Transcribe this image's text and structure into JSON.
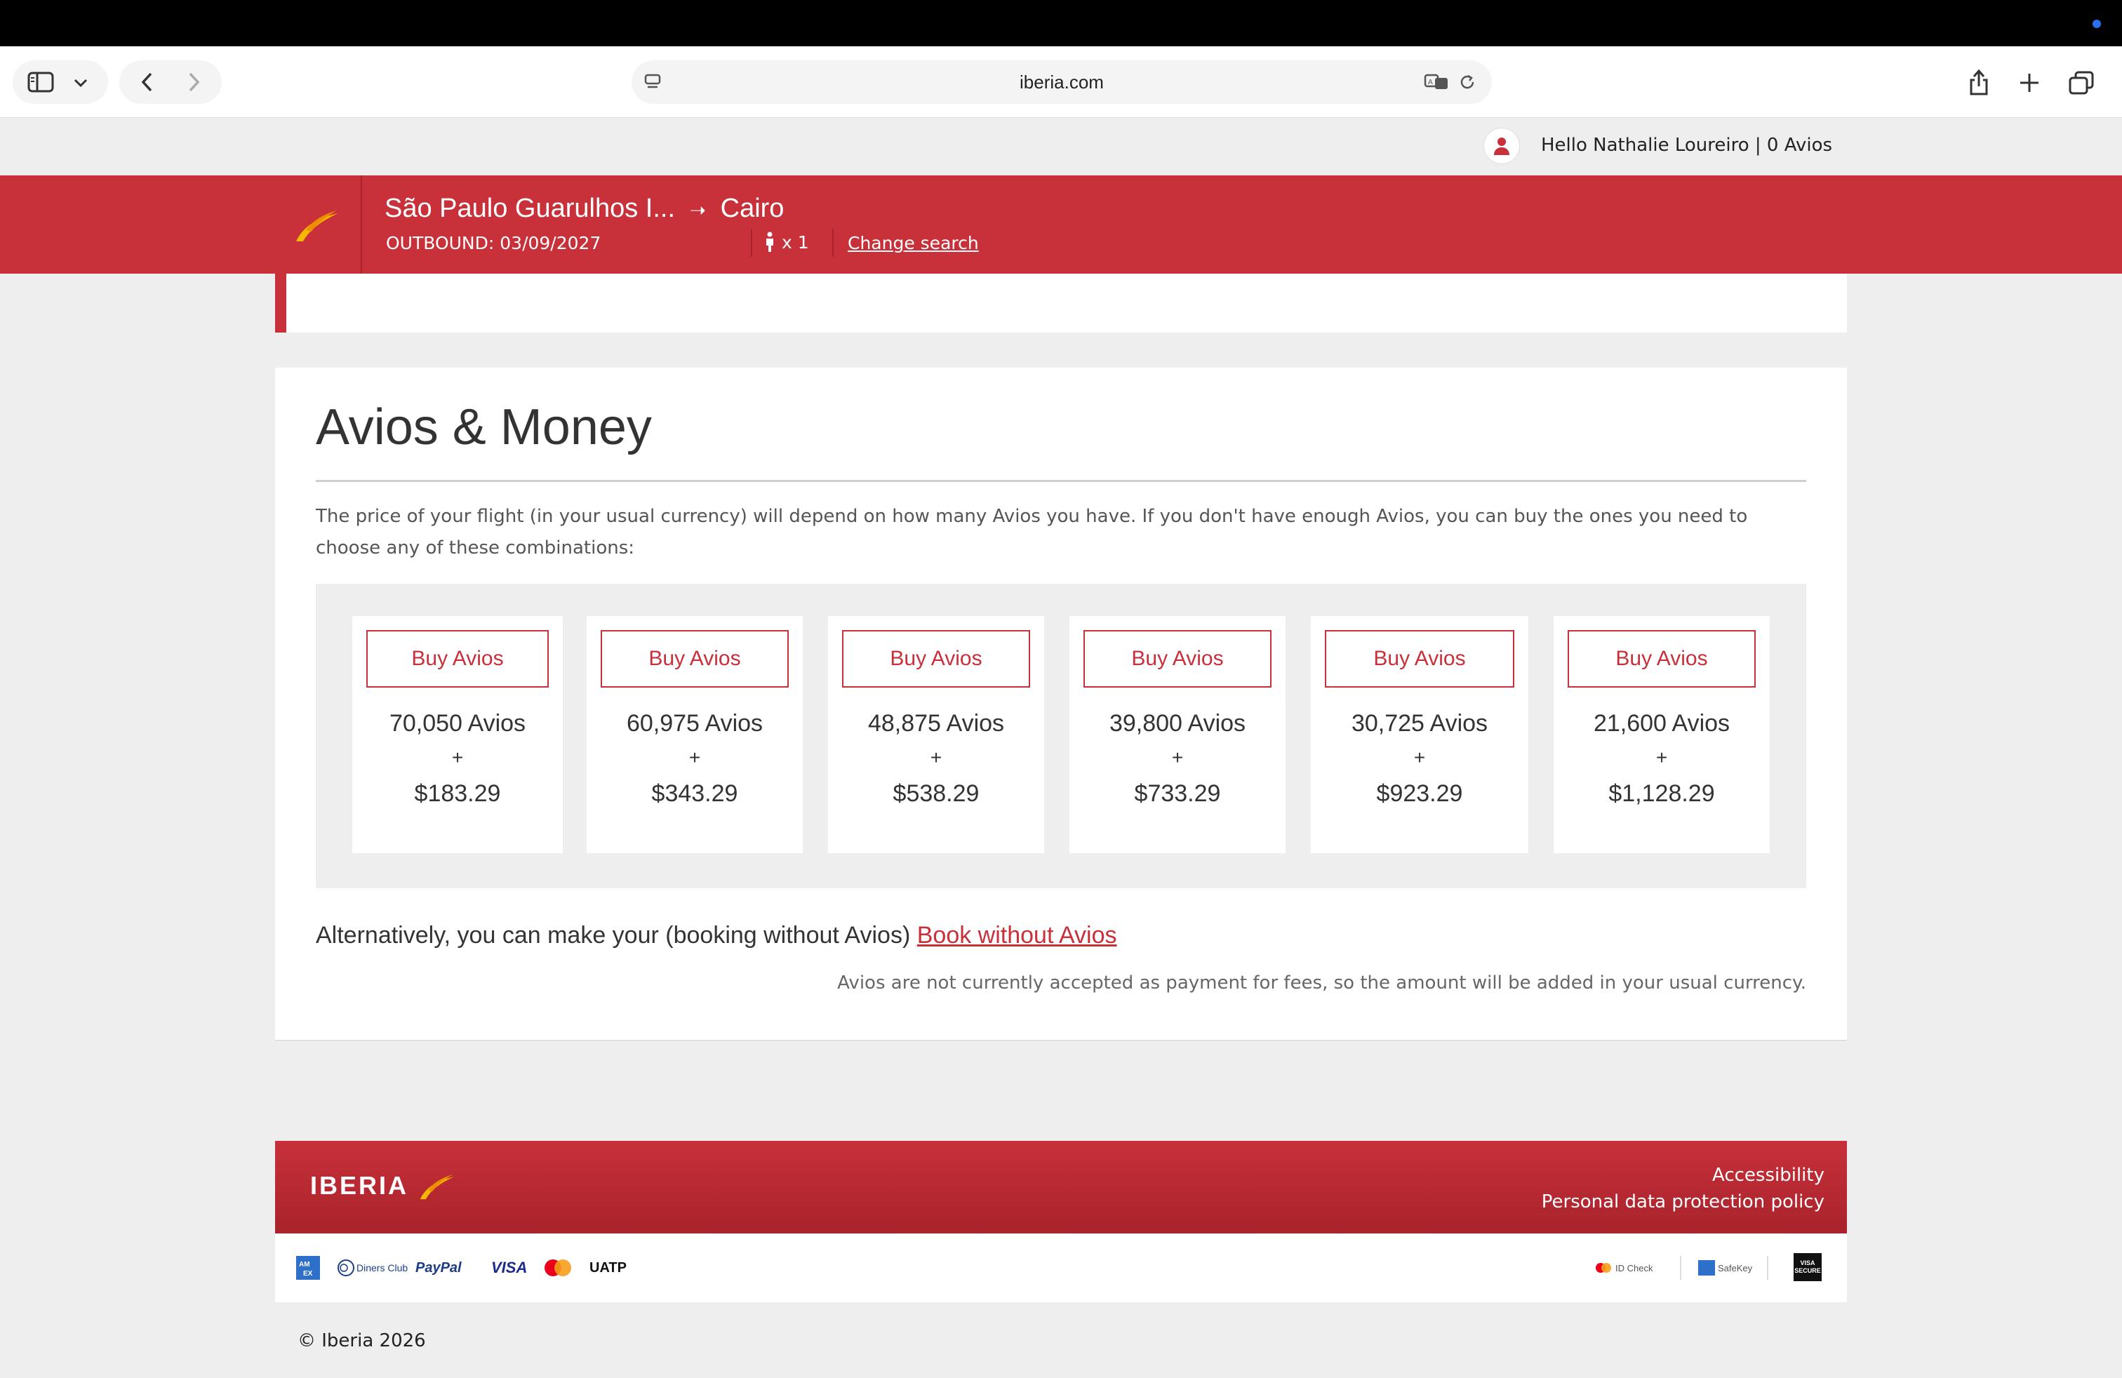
{
  "browser": {
    "url": "iberia.com"
  },
  "user": {
    "greeting": "Hello Nathalie Loureiro  |  0 Avios"
  },
  "flight": {
    "route_from": "São Paulo Guarulhos I...",
    "arrow": "➝",
    "route_to": "Cairo",
    "outbound": "OUTBOUND: 03/09/2027",
    "passengers": "x 1",
    "change_search": "Change search"
  },
  "main": {
    "title": "Avios & Money",
    "intro": "The price of your flight (in your usual currency) will depend on how many Avios you have. If you don't have enough Avios, you can buy the ones you need to choose any of these combinations:",
    "buy_label": "Buy Avios",
    "plus": "+",
    "options": [
      {
        "avios": "70,050 Avios",
        "money": "$183.29"
      },
      {
        "avios": "60,975 Avios",
        "money": "$343.29"
      },
      {
        "avios": "48,875 Avios",
        "money": "$538.29"
      },
      {
        "avios": "39,800 Avios",
        "money": "$733.29"
      },
      {
        "avios": "30,725 Avios",
        "money": "$923.29"
      },
      {
        "avios": "21,600 Avios",
        "money": "$1,128.29"
      }
    ],
    "alt_text": "Alternatively, you can make your (booking without Avios)",
    "alt_link": "Book without Avios",
    "fees_note": "Avios are not currently accepted as payment for fees, so the amount will be added in your usual currency."
  },
  "footer": {
    "brand": "IBERIA",
    "links": [
      "Accessibility",
      "Personal data protection policy"
    ],
    "payment_methods": [
      "AMEX",
      "Diners Club",
      "PayPal",
      "VISA",
      "Mastercard",
      "UATP"
    ],
    "security_badges": [
      "ID Check",
      "SafeKey",
      "VISA SECURE"
    ],
    "copyright": "© Iberia 2026"
  },
  "colors": {
    "brand_red": "#c8303a",
    "brand_yellow": "#f5b800"
  }
}
